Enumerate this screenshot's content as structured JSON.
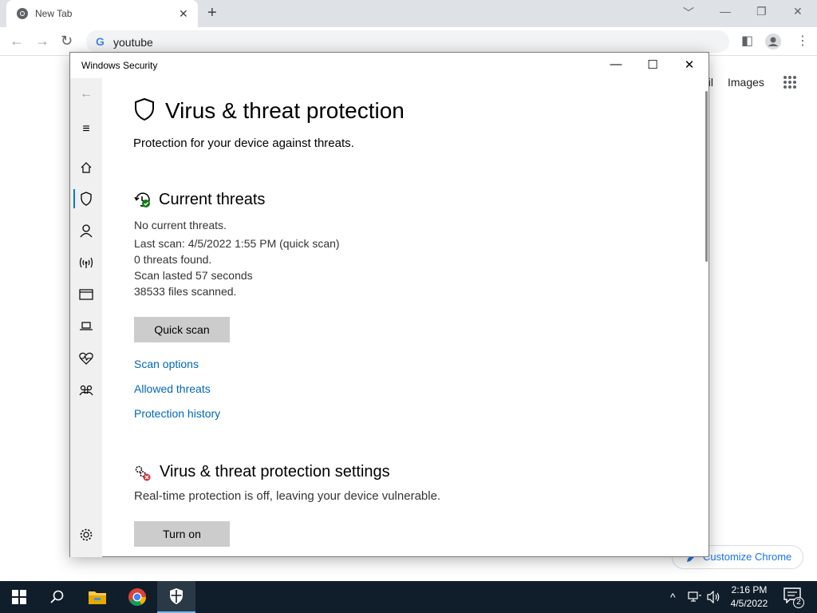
{
  "chrome": {
    "tab_title": "New Tab",
    "tab_close": "✕",
    "new_tab": "+",
    "win_controls": [
      "﹀",
      "—",
      "❐",
      "✕"
    ],
    "omnibox_text": "youtube",
    "ntp_links": [
      "ail",
      "Images"
    ],
    "customize_label": "Customize Chrome"
  },
  "windows_security": {
    "window_title": "Windows Security",
    "title": "Virus & threat protection",
    "subtitle": "Protection for your device against threats.",
    "current_threats": {
      "heading": "Current threats",
      "lines": [
        "No current threats.",
        "Last scan: 4/5/2022 1:55 PM (quick scan)",
        "0 threats found.",
        "Scan lasted 57 seconds",
        "38533 files scanned."
      ],
      "quick_scan_label": "Quick scan",
      "links": [
        "Scan options",
        "Allowed threats",
        "Protection history"
      ]
    },
    "settings": {
      "heading": "Virus & threat protection settings",
      "description": "Real-time protection is off, leaving your device vulnerable.",
      "turn_on_label": "Turn on"
    },
    "sidebar_icons": [
      "back-arrow-icon",
      "hamburger-menu-icon",
      "home-icon",
      "shield-icon",
      "person-icon",
      "wireless-icon",
      "app-browser-icon",
      "laptop-icon",
      "heart-icon",
      "family-icon",
      "settings-gear-icon"
    ],
    "accent_color": "#0078d4",
    "link_color": "#0067b8",
    "status_ok_color": "#107c10",
    "status_warn_color": "#d13438"
  },
  "taskbar": {
    "items": [
      "windows-start-icon",
      "search-icon",
      "file-explorer-icon",
      "chrome-icon",
      "windows-security-icon"
    ],
    "time": "2:16 PM",
    "date": "4/5/2022",
    "notification_count": "2",
    "tray": [
      "^",
      "network-icon",
      "volume-icon"
    ]
  }
}
